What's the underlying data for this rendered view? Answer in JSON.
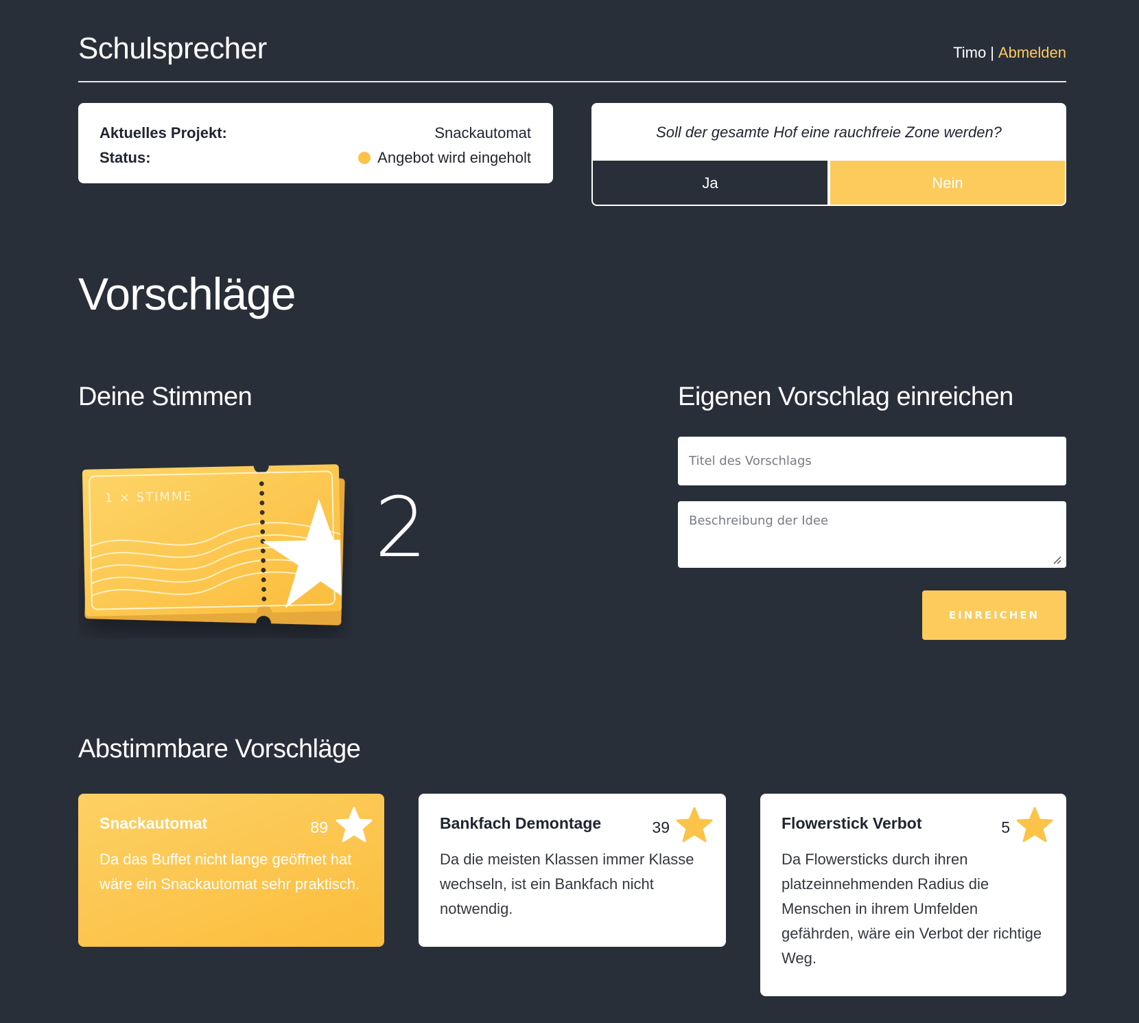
{
  "header": {
    "site_title": "Schulsprecher",
    "username": "Timo",
    "separator": "|",
    "logout_label": "Abmelden"
  },
  "project": {
    "current_label": "Aktuelles Projekt:",
    "current_value": "Snackautomat",
    "status_label": "Status:",
    "status_value": "Angebot wird eingeholt",
    "status_color": "#fbc448"
  },
  "poll": {
    "question": "Soll der gesamte Hof eine rauchfreie Zone werden?",
    "yes_label": "Ja",
    "no_label": "Nein"
  },
  "section_title": "Vorschläge",
  "votes": {
    "heading": "Deine Stimmen",
    "ticket_label": "1 × STIMME",
    "count": "2"
  },
  "submit_form": {
    "heading": "Eigenen Vorschlag einreichen",
    "title_placeholder": "Titel des Vorschlags",
    "description_placeholder": "Beschreibung der Idee",
    "submit_label": "EINREICHEN"
  },
  "proposals": {
    "heading": "Abstimmbare Vorschläge",
    "items": [
      {
        "title": "Snackautomat",
        "votes": "89",
        "description": "Da das Buffet nicht lange geöffnet hat wäre ein Snackautomat sehr praktisch.",
        "voted": true
      },
      {
        "title": "Bankfach Demontage",
        "votes": "39",
        "description": "Da die meisten Klassen immer Klasse wechseln, ist ein Bankfach nicht notwendig.",
        "voted": false
      },
      {
        "title": "Flowerstick Verbot",
        "votes": "5",
        "description": "Da Flowersticks durch ihren platzeinnehmenden Radius die Menschen in ihrem Umfelden gefährden, wäre ein Verbot der richtige Weg.",
        "voted": false
      }
    ]
  },
  "colors": {
    "background": "#292f39",
    "accent": "#fccb5c",
    "card": "#ffffff",
    "star": "#fbc448"
  },
  "icons": {
    "ticket": "vote-ticket-icon",
    "star": "star-icon",
    "status": "status-dot-icon"
  }
}
